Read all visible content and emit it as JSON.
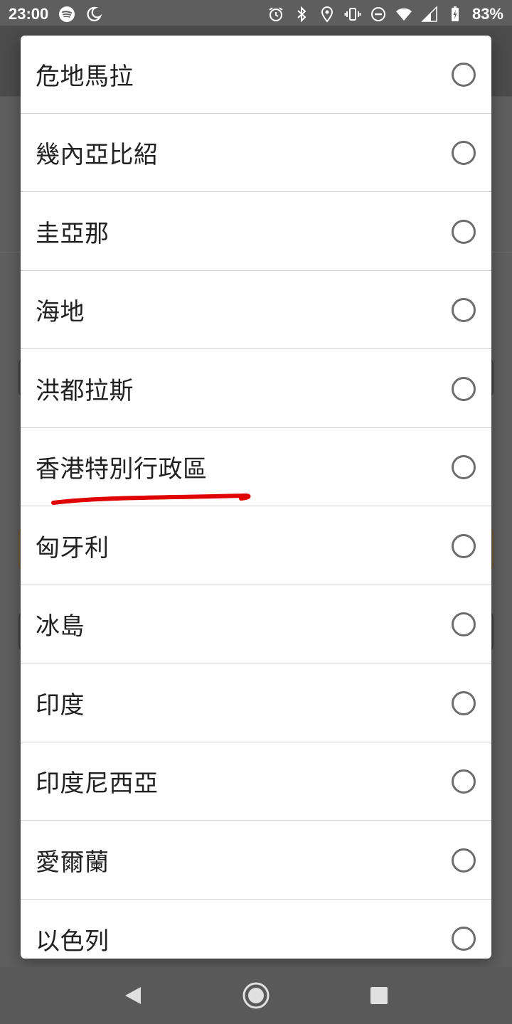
{
  "status_bar": {
    "time": "23:00",
    "battery_percent": "83%",
    "left_icons": [
      "spotify-icon",
      "moon-icon"
    ],
    "right_icons": [
      "alarm-icon",
      "bluetooth-icon",
      "location-icon",
      "vibrate-icon",
      "do-not-disturb-icon",
      "wifi-icon",
      "signal-icon",
      "battery-icon"
    ]
  },
  "dialog": {
    "options": [
      {
        "label": "危地馬拉",
        "selected": false
      },
      {
        "label": "幾內亞比紹",
        "selected": false
      },
      {
        "label": "圭亞那",
        "selected": false
      },
      {
        "label": "海地",
        "selected": false
      },
      {
        "label": "洪都拉斯",
        "selected": false
      },
      {
        "label": "香港特別行政區",
        "selected": false,
        "annotated": true
      },
      {
        "label": "匈牙利",
        "selected": false
      },
      {
        "label": "冰島",
        "selected": false
      },
      {
        "label": "印度",
        "selected": false
      },
      {
        "label": "印度尼西亞",
        "selected": false
      },
      {
        "label": "愛爾蘭",
        "selected": false
      },
      {
        "label": "以色列",
        "selected": false
      }
    ]
  },
  "annotation": {
    "color": "#e00000"
  },
  "nav_bar": {
    "icons": [
      "back-icon",
      "home-icon",
      "recents-icon"
    ]
  }
}
